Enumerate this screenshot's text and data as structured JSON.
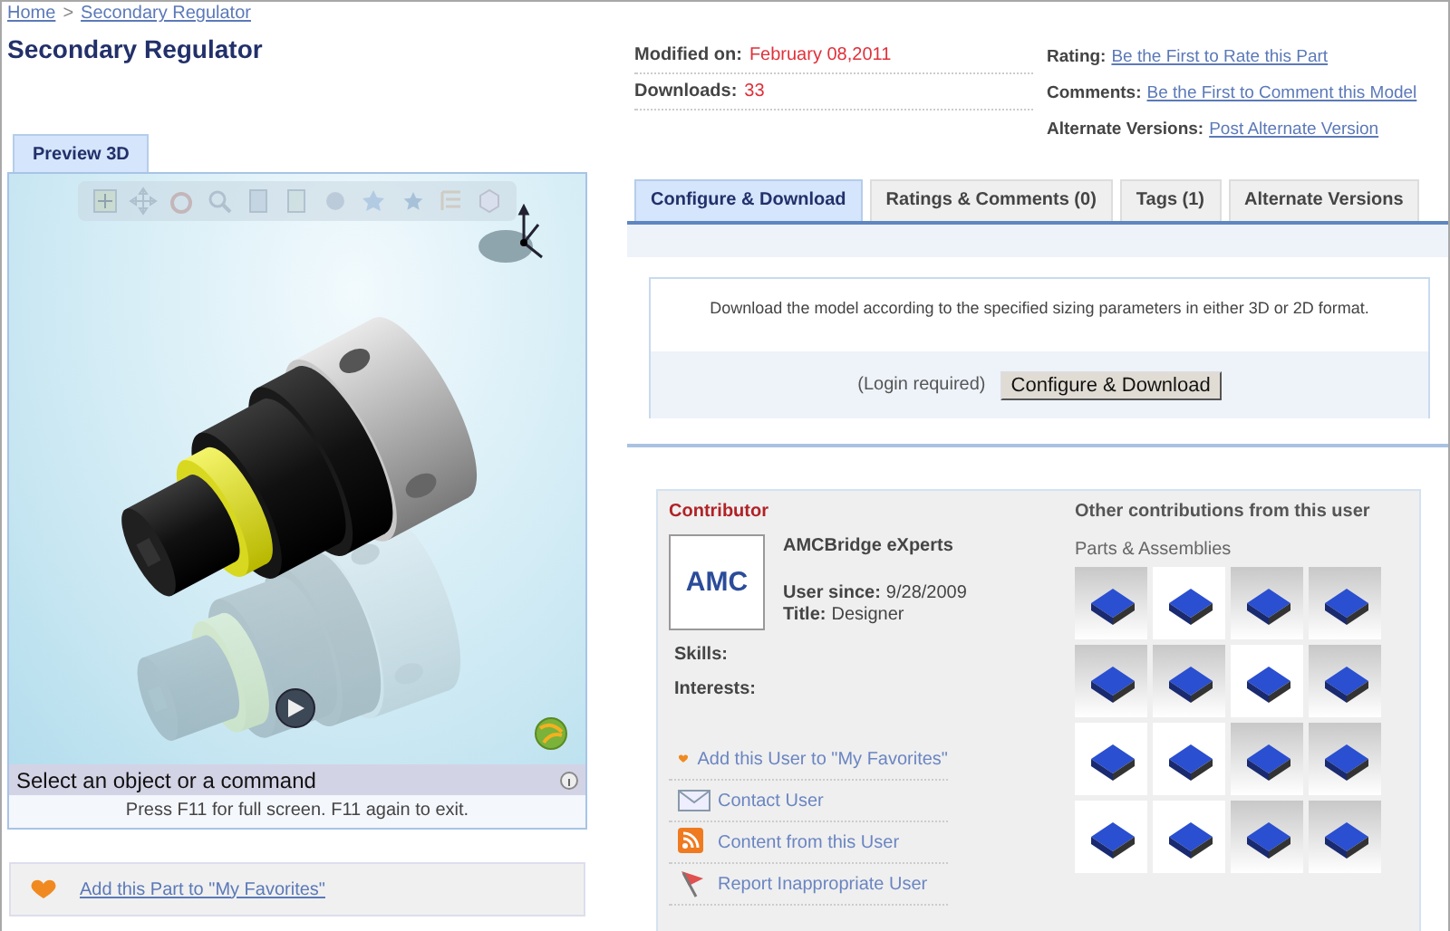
{
  "breadcrumb": {
    "items": [
      {
        "label": "Home"
      },
      {
        "label": "Secondary Regulator"
      }
    ],
    "separator": ">"
  },
  "title": "Secondary Regulator",
  "preview": {
    "tab": {
      "label": "Preview 3D",
      "selected": true
    },
    "status": "Select an object or a command",
    "hint": "Press F11 for full screen. F11 again to exit."
  },
  "favorites_link": "Add this Part to \"My Favorites\"",
  "meta_left": [
    {
      "label": "Modified on:",
      "value": "February 08,2011",
      "kind": "highlight"
    },
    {
      "label": "Downloads:",
      "value": "33",
      "kind": "highlight"
    }
  ],
  "meta_right": [
    {
      "label": "Rating:",
      "value": "Be the First to Rate this Part",
      "kind": "link"
    },
    {
      "label": "Comments:",
      "value": "Be the First to Comment this Model",
      "kind": "link"
    },
    {
      "label": "Alternate Versions:",
      "value": "Post Alternate Version",
      "kind": "link"
    }
  ],
  "tabs": [
    {
      "label": "Configure & Download",
      "selected": true
    },
    {
      "label": "Ratings & Comments (0)",
      "selected": false
    },
    {
      "label": "Tags (1)",
      "selected": false
    },
    {
      "label": "Alternate Versions",
      "selected": false
    }
  ],
  "configure": {
    "description": "Download the model according to the specified sizing parameters in either 3D or 2D format.",
    "note": "(Login required)",
    "button": "Configure & Download"
  },
  "contributor": {
    "heading": "Contributor",
    "logo_text": "AMC",
    "name": "AMCBridge eXperts",
    "fields": [
      {
        "label": "User since:",
        "value": "9/28/2009"
      },
      {
        "label": "Title:",
        "value": "Designer"
      }
    ],
    "extra_fields": [
      {
        "label": "Skills:"
      },
      {
        "label": "Interests:"
      }
    ],
    "links": [
      {
        "label": "Add this User to \"My Favorites\"",
        "kind": "favorite"
      },
      {
        "label": "Contact User",
        "kind": "contact"
      },
      {
        "label": "Content from this User",
        "kind": "rss"
      },
      {
        "label": "Report Inappropriate User",
        "kind": "report"
      }
    ]
  },
  "other": {
    "heading": "Other contributions from this user",
    "subheading": "Parts & Assemblies",
    "thumbnails": [
      {
        "kind": "shaded"
      },
      {
        "kind": "white"
      },
      {
        "kind": "shaded"
      },
      {
        "kind": "shaded"
      },
      {
        "kind": "shaded"
      },
      {
        "kind": "shaded"
      },
      {
        "kind": "white"
      },
      {
        "kind": "shaded"
      },
      {
        "kind": "white"
      },
      {
        "kind": "white"
      },
      {
        "kind": "shaded"
      },
      {
        "kind": "shaded"
      },
      {
        "kind": "white"
      },
      {
        "kind": "white"
      },
      {
        "kind": "shaded"
      },
      {
        "kind": "shaded"
      }
    ]
  }
}
